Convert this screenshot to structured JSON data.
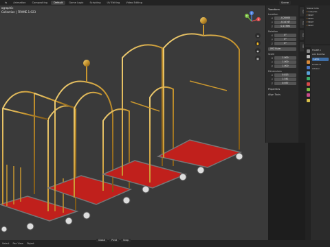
{
  "topbar": {
    "tabs": [
      "ts",
      "Animation",
      "Compositing",
      "Default",
      "Game Logic",
      "Scripting",
      "UV Editing",
      "Video Editing"
    ],
    "active_index": 3,
    "scene": "Scene"
  },
  "viewport": {
    "info_line1": "ographic",
    "info_line2": "Collection | FRAME.1.023"
  },
  "npanel": {
    "title": "Transform",
    "location_label": "Location",
    "location": [
      "-0.20000",
      "-0.14747",
      "0.17396"
    ],
    "rotation_label": "Rotation",
    "rotation": [
      "0°",
      "0°",
      "0°"
    ],
    "rotation_mode": "XYZ Euler",
    "scale_label": "Scale",
    "scale": [
      "1.000",
      "1.000",
      "1.000"
    ],
    "dimensions_label": "Dimensions",
    "dimensions": [
      "0.813",
      "1.541",
      "0.937"
    ],
    "axes": [
      "X",
      "Y",
      "Z"
    ],
    "fold1": "Properties",
    "fold2": "Align Tools"
  },
  "sidetabs": [
    "Item",
    "Tool",
    "View",
    "Edit"
  ],
  "outliner": {
    "rows": [
      "Scene Colle",
      "Collectio",
      "BOLT",
      "BOLT",
      "BOLT",
      "BOLT"
    ]
  },
  "props": {
    "object_name": "FRAME.1",
    "modifier": "Add Modifier",
    "field1": "Lamp",
    "field2": "Levels Vi",
    "field3": "Advanc"
  },
  "gizmo": {
    "x": "X",
    "y": "Y",
    "z": "Z"
  },
  "statusbar": {
    "left": [
      "Select",
      "Pan View",
      "Object"
    ],
    "viewport_header": [
      "Global",
      "Pivot",
      "Snap"
    ]
  }
}
